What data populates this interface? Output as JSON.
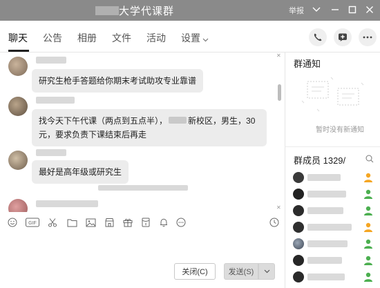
{
  "window": {
    "title": "大学代课群",
    "report_label": "举报"
  },
  "tabs": [
    {
      "label": "聊天"
    },
    {
      "label": "公告"
    },
    {
      "label": "相册"
    },
    {
      "label": "文件"
    },
    {
      "label": "活动"
    },
    {
      "label": "设置"
    }
  ],
  "messages": [
    {
      "text": "研究生枪手答题给你期末考试助攻专业靠谱"
    },
    {
      "text_line1": "找今天下午代课（两点到五点半），",
      "text_line1_tail": "新校区，男生，30",
      "text_line2": "元，要求负责下课结束后再走"
    },
    {
      "text": "最好是高年级或研究生"
    }
  ],
  "composer": {
    "close_label": "关闭(C)",
    "send_label": "发送(S)"
  },
  "group_notice": {
    "title": "群通知",
    "empty_text": "暂时没有新通知"
  },
  "members": {
    "title": "群成员 1329/",
    "count_visible": 7
  },
  "colors": {
    "titlebar": "#8a8a8a",
    "bubble": "#ececec",
    "role_admin": "#f5a623",
    "role_member": "#4caf50"
  }
}
